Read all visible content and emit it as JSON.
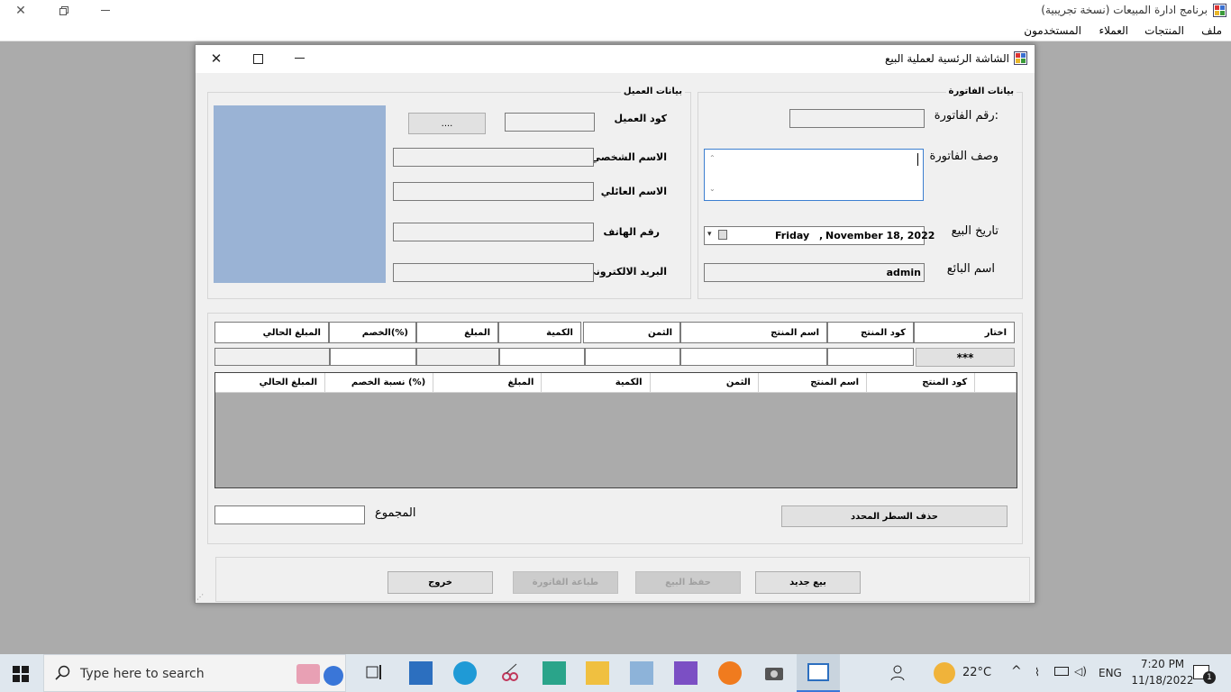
{
  "app": {
    "title": "برنامج ادارة المبيعات (نسخة تجريبية)",
    "menu": [
      "ملف",
      "المنتجات",
      "العملاء",
      "المستخدمون"
    ]
  },
  "dialog": {
    "title": "الشاشة الرئسية لعملية البيع",
    "invoice_group": {
      "title": "بيانات الفاتورة",
      "number_label": "رقم الفاتورة:",
      "desc_label": "وصف الفاتورة",
      "date_label": "تاريخ البيع",
      "date_day": "Friday",
      "date_sep": ",",
      "date_value": "November 18, 2022",
      "seller_label": "اسم البائع",
      "seller_value": "admin"
    },
    "client_group": {
      "title": "بيانات العميل",
      "code_label": "كود العميل",
      "browse_label": "....",
      "first_name_label": "الاسم الشخصي",
      "last_name_label": "الاسم العائلي",
      "phone_label": "رقم الهاتف",
      "email_label": "البريد الالكتروني"
    },
    "entry_headers": [
      "اختار",
      "كود المنتج",
      "اسم المنتج",
      "الثمن",
      "الكمية",
      "المبلغ",
      "الخصم(%)",
      "المبلغ الحالي"
    ],
    "choose_button": "***",
    "grid_headers": [
      "كود المنتج",
      "اسم المنتج",
      "الثمن",
      "الكمية",
      "المبلغ",
      "نسبة الخصم (%)",
      "المبلغ الحالي"
    ],
    "delete_row_button": "حذف السطر المحدد",
    "total_label": "المجموع",
    "buttons": {
      "new_sale": "بيع جديد",
      "save_sale": "حفظ البيع",
      "print_invoice": "طباعة الفاتورة",
      "exit": "خروج"
    }
  },
  "taskbar": {
    "search_placeholder": "Type here to search",
    "weather": "22°C",
    "language": "ENG",
    "time": "7:20 PM",
    "date": "11/18/2022",
    "notifications": "1"
  },
  "colors": {
    "client_bg": "#ababab",
    "photo_box": "#9ab3d5",
    "taskbar": "#dfe7ee"
  }
}
